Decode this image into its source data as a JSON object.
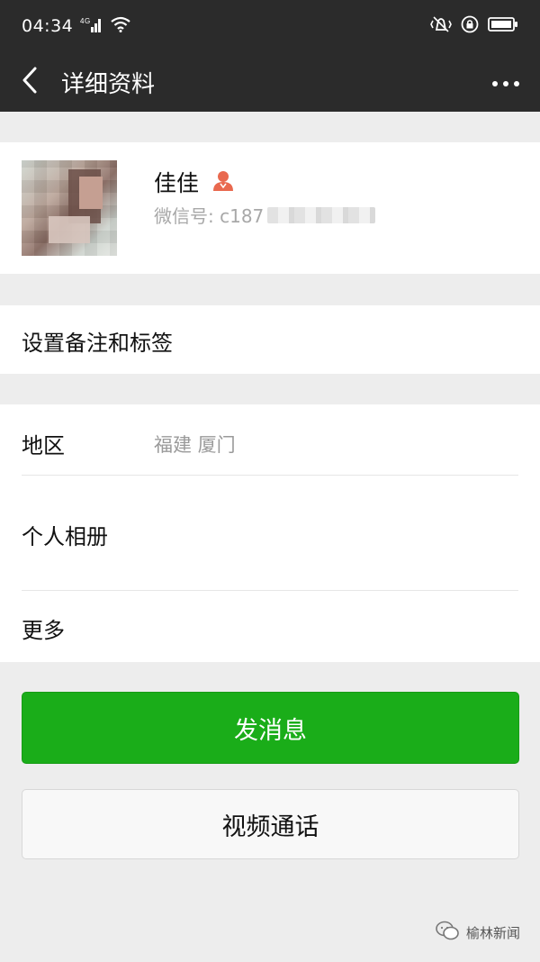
{
  "status_bar": {
    "time": "04:34",
    "network": "4G",
    "icons": [
      "signal-icon",
      "wifi-icon",
      "vibrate-icon",
      "lock-rotation-icon",
      "battery-icon"
    ]
  },
  "nav": {
    "title": "详细资料",
    "back_icon": "chevron-left-icon",
    "more_icon": "more-dots-icon"
  },
  "profile": {
    "name": "佳佳",
    "gender_icon": "female-user-icon",
    "wechat_id_label": "微信号: c187"
  },
  "remark": {
    "label": "设置备注和标签"
  },
  "info": {
    "region_label": "地区",
    "region_value": "福建  厦门",
    "album_label": "个人相册",
    "more_label": "更多"
  },
  "actions": {
    "send_message": "发消息",
    "video_call": "视频通话"
  },
  "watermark": {
    "text": "榆林新闻"
  },
  "colors": {
    "header_bg": "#2b2b2b",
    "primary_green": "#1aad19",
    "page_bg": "#ededed",
    "female_icon": "#e9694f"
  }
}
